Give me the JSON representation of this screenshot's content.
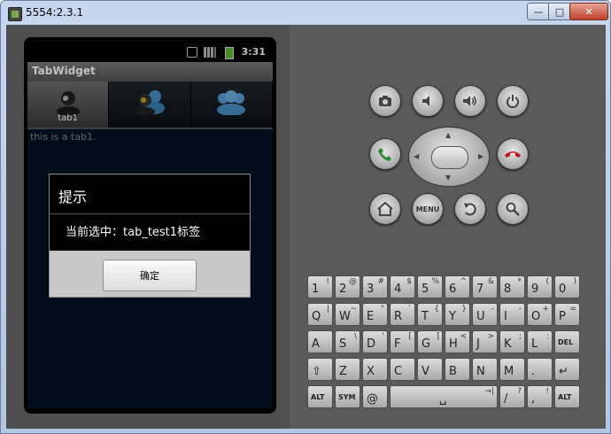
{
  "window": {
    "title": "5554:2.3.1",
    "min": "—",
    "max": "□",
    "close": "✕"
  },
  "status_bar": {
    "time": "3:31"
  },
  "app": {
    "title": "TabWidget"
  },
  "tabs": [
    {
      "label": "tab1",
      "icon": "person-icon"
    },
    {
      "label": "",
      "icon": "people-icon"
    },
    {
      "label": "",
      "icon": "group-icon"
    }
  ],
  "content": {
    "text": "this is a tab1."
  },
  "dialog": {
    "title": "提示",
    "message": "当前选中：tab_test1标签",
    "button": "确定"
  },
  "controls": {
    "camera": "camera-icon",
    "vol_down": "volume-down-icon",
    "vol_up": "volume-up-icon",
    "power": "power-icon",
    "call": "call-icon",
    "end_call": "end-call-icon",
    "home": "home-icon",
    "menu": "MENU",
    "back": "back-icon",
    "search": "search-icon"
  },
  "keyboard": {
    "rows": [
      [
        {
          "m": "1",
          "a": "!"
        },
        {
          "m": "2",
          "a": "@"
        },
        {
          "m": "3",
          "a": "#"
        },
        {
          "m": "4",
          "a": "$"
        },
        {
          "m": "5",
          "a": "%"
        },
        {
          "m": "6",
          "a": "^"
        },
        {
          "m": "7",
          "a": "&"
        },
        {
          "m": "8",
          "a": "*"
        },
        {
          "m": "9",
          "a": "("
        },
        {
          "m": "0",
          "a": ")"
        }
      ],
      [
        {
          "m": "Q",
          "a": "|"
        },
        {
          "m": "W",
          "a": "~"
        },
        {
          "m": "E",
          "a": "\""
        },
        {
          "m": "R",
          "a": "`"
        },
        {
          "m": "T",
          "a": "{"
        },
        {
          "m": "Y",
          "a": "}"
        },
        {
          "m": "U",
          "a": "-"
        },
        {
          "m": "I",
          "a": "-"
        },
        {
          "m": "O",
          "a": "+"
        },
        {
          "m": "P",
          "a": "="
        }
      ],
      [
        {
          "m": "A",
          "a": ""
        },
        {
          "m": "S",
          "a": "\\"
        },
        {
          "m": "D",
          "a": "'"
        },
        {
          "m": "F",
          "a": "["
        },
        {
          "m": "G",
          "a": "]"
        },
        {
          "m": "H",
          "a": "<"
        },
        {
          "m": "J",
          "a": ">"
        },
        {
          "m": "K",
          "a": ";"
        },
        {
          "m": "L",
          "a": ":"
        },
        {
          "m": "DEL",
          "a": ""
        }
      ],
      [
        {
          "m": "⇧",
          "a": ""
        },
        {
          "m": "Z",
          "a": ""
        },
        {
          "m": "X",
          "a": ""
        },
        {
          "m": "C",
          "a": ""
        },
        {
          "m": "V",
          "a": ""
        },
        {
          "m": "B",
          "a": ""
        },
        {
          "m": "N",
          "a": ""
        },
        {
          "m": "M",
          "a": ""
        },
        {
          "m": ".",
          "a": ""
        },
        {
          "m": "↵",
          "a": ""
        }
      ],
      [
        {
          "m": "ALT",
          "a": ""
        },
        {
          "m": "SYM",
          "a": ""
        },
        {
          "m": "@",
          "a": ""
        },
        {
          "m": "␣",
          "a": "→|"
        },
        {
          "m": "/",
          "a": "?"
        },
        {
          "m": ",",
          "a": "!"
        },
        {
          "m": "ALT",
          "a": ""
        }
      ]
    ]
  }
}
